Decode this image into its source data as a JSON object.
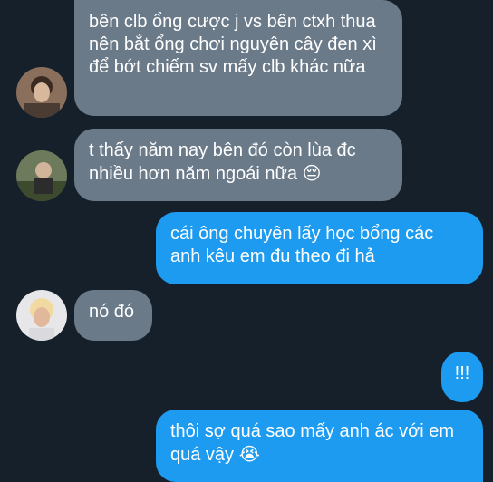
{
  "messages": [
    {
      "side": "in",
      "text": "bên clb ổng cược j vs bên ctxh thua nên bắt ổng chơi nguyên cây đen xì để bớt chiếm sv mấy clb khác nữa",
      "avatar": "avatar-1"
    },
    {
      "side": "in",
      "text": "t thấy năm nay bên đó còn lùa đc nhiều hơn năm ngoái nữa",
      "emoji": "😔",
      "avatar": "avatar-2"
    },
    {
      "side": "out",
      "text": "cái ông chuyên lấy học bổng các anh kêu em đu theo đi hả"
    },
    {
      "side": "in",
      "text": "nó đó",
      "avatar": "avatar-3"
    },
    {
      "side": "out",
      "text": "!!!"
    },
    {
      "side": "out",
      "text": "thôi sợ quá sao mấy anh ác với em quá vậy",
      "emoji": "😭"
    }
  ],
  "colors": {
    "background": "#15202b",
    "incoming": "#6b7a89",
    "outgoing": "#1d9bf0"
  }
}
